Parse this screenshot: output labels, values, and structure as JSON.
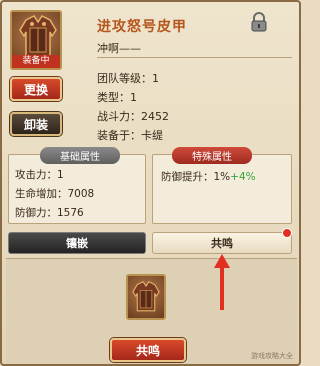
{
  "item": {
    "name": "进攻怒号皮甲",
    "desc": "冲啊——",
    "equipped_label": "装备中"
  },
  "buttons": {
    "replace": "更换",
    "unequip": "卸装",
    "resonance": "共鸣"
  },
  "info": [
    "团队等级：1",
    "类型：1",
    "战斗力：2452",
    "装备于：卡缇"
  ],
  "basic_attributes": {
    "header": "基础属性",
    "lines": [
      "攻击力：1",
      "生命增加：7008",
      "防御力：1576"
    ]
  },
  "special_attributes": {
    "header": "特殊属性",
    "prefix": "防御提升：",
    "base": "1%",
    "bonus": "+4%"
  },
  "tabs": {
    "inlay": "镶嵌",
    "resonance": "共鸣"
  },
  "watermark": "游戏攻略大全"
}
